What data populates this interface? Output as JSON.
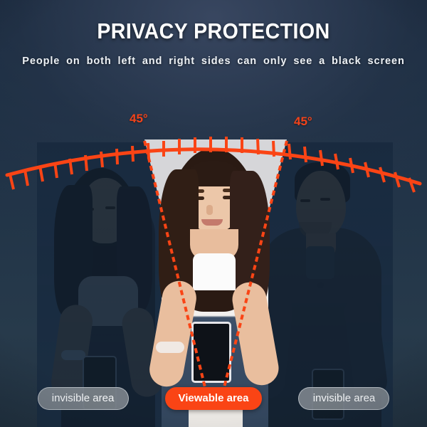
{
  "header": {
    "title": "PRIVACY PROTECTION",
    "subtitle": "People on both left and right sides can only see a black screen"
  },
  "diagram": {
    "angle_left_label": "45°",
    "angle_right_label": "45°",
    "cone_fill_color": "#d6d6d9",
    "arc_color": "#fa4415",
    "dashed_edge_color": "#fa4415",
    "tick_count": 27,
    "people": [
      {
        "position": "left",
        "描述": "left-person",
        "label": "woman-looking-at-phone",
        "state": "dimmed"
      },
      {
        "position": "center",
        "label": "woman-looking-at-phone",
        "state": "visible"
      },
      {
        "position": "right",
        "label": "man-looking-at-phone",
        "state": "dimmed"
      }
    ]
  },
  "footer": {
    "pills": [
      {
        "label": "invisible area",
        "style": "gray"
      },
      {
        "label": "Viewable area",
        "style": "orange"
      },
      {
        "label": "invisible area",
        "style": "gray"
      }
    ]
  },
  "colors": {
    "accent_orange": "#fa4415",
    "background_navy": "#1b2e42",
    "pill_gray": "#838a91",
    "cone_gray": "#d6d6d9",
    "text_white": "#ffffff"
  }
}
